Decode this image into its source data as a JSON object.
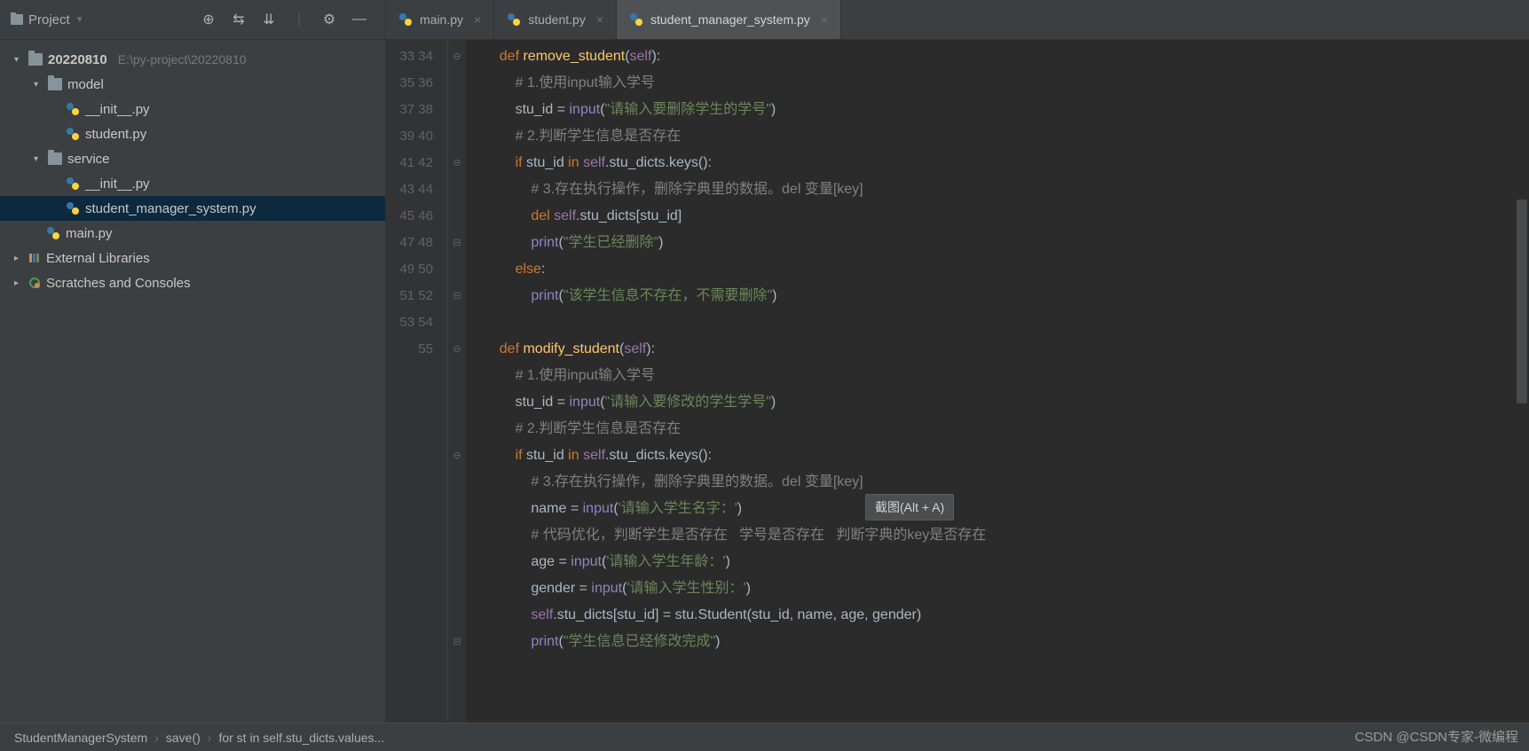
{
  "toolbar": {
    "project_label": "Project"
  },
  "tabs": [
    {
      "label": "main.py",
      "active": false
    },
    {
      "label": "student.py",
      "active": false
    },
    {
      "label": "student_manager_system.py",
      "active": true
    }
  ],
  "tree": {
    "root": {
      "name": "20220810",
      "hint": "E:\\py-project\\20220810"
    },
    "model": {
      "name": "model"
    },
    "model_init": {
      "name": "__init__.py"
    },
    "model_student": {
      "name": "student.py"
    },
    "service": {
      "name": "service"
    },
    "service_init": {
      "name": "__init__.py"
    },
    "service_sms": {
      "name": "student_manager_system.py"
    },
    "main": {
      "name": "main.py"
    },
    "ext_lib": {
      "name": "External Libraries"
    },
    "scratch": {
      "name": "Scratches and Consoles"
    }
  },
  "gutter": {
    "start": 33,
    "end": 55
  },
  "code_lines": [
    {
      "n": 33,
      "tokens": [
        [
          "    ",
          ""
        ],
        [
          "def ",
          "k"
        ],
        [
          "remove_student",
          "fn"
        ],
        [
          "(",
          "op"
        ],
        [
          "self",
          "pr"
        ],
        [
          "):",
          "op"
        ]
      ]
    },
    {
      "n": 34,
      "tokens": [
        [
          "        ",
          ""
        ],
        [
          "# 1.使用input输入学号",
          "c"
        ]
      ]
    },
    {
      "n": 35,
      "tokens": [
        [
          "        ",
          ""
        ],
        [
          "stu_id = ",
          "i"
        ],
        [
          "input",
          "builtin"
        ],
        [
          "(",
          "op"
        ],
        [
          "\"请输入要删除学生的学号\"",
          "s"
        ],
        [
          ")",
          "op"
        ]
      ]
    },
    {
      "n": 36,
      "tokens": [
        [
          "        ",
          ""
        ],
        [
          "# 2.判断学生信息是否存在",
          "c"
        ]
      ]
    },
    {
      "n": 37,
      "tokens": [
        [
          "        ",
          ""
        ],
        [
          "if ",
          "k"
        ],
        [
          "stu_id ",
          "i"
        ],
        [
          "in ",
          "k"
        ],
        [
          "self",
          "pr"
        ],
        [
          ".stu_dicts.keys():",
          "i"
        ]
      ]
    },
    {
      "n": 38,
      "tokens": [
        [
          "            ",
          ""
        ],
        [
          "# 3.存在执行操作，删除字典里的数据。del 变量[key]",
          "c"
        ]
      ]
    },
    {
      "n": 39,
      "tokens": [
        [
          "            ",
          ""
        ],
        [
          "del ",
          "k"
        ],
        [
          "self",
          "pr"
        ],
        [
          ".stu_dicts[stu_id]",
          "i"
        ]
      ]
    },
    {
      "n": 40,
      "tokens": [
        [
          "            ",
          ""
        ],
        [
          "print",
          "builtin"
        ],
        [
          "(",
          "op"
        ],
        [
          "\"学生已经删除\"",
          "s"
        ],
        [
          ")",
          "op"
        ]
      ]
    },
    {
      "n": 41,
      "tokens": [
        [
          "        ",
          ""
        ],
        [
          "else",
          "k"
        ],
        [
          ":",
          "op"
        ]
      ]
    },
    {
      "n": 42,
      "tokens": [
        [
          "            ",
          ""
        ],
        [
          "print",
          "builtin"
        ],
        [
          "(",
          "op"
        ],
        [
          "\"该学生信息不存在，不需要删除\"",
          "s"
        ],
        [
          ")",
          "op"
        ]
      ]
    },
    {
      "n": 43,
      "tokens": [
        [
          "",
          ""
        ]
      ]
    },
    {
      "n": 44,
      "tokens": [
        [
          "    ",
          ""
        ],
        [
          "def ",
          "k"
        ],
        [
          "modify_student",
          "fn"
        ],
        [
          "(",
          "op"
        ],
        [
          "self",
          "pr"
        ],
        [
          "):",
          "op"
        ]
      ]
    },
    {
      "n": 45,
      "tokens": [
        [
          "        ",
          ""
        ],
        [
          "# 1.使用input输入学号",
          "c"
        ]
      ]
    },
    {
      "n": 46,
      "tokens": [
        [
          "        ",
          ""
        ],
        [
          "stu_id = ",
          "i"
        ],
        [
          "input",
          "builtin"
        ],
        [
          "(",
          "op"
        ],
        [
          "\"请输入要修改的学生学号\"",
          "s"
        ],
        [
          ")",
          "op"
        ]
      ]
    },
    {
      "n": 47,
      "tokens": [
        [
          "        ",
          ""
        ],
        [
          "# 2.判断学生信息是否存在",
          "c"
        ]
      ]
    },
    {
      "n": 48,
      "tokens": [
        [
          "        ",
          ""
        ],
        [
          "if ",
          "k"
        ],
        [
          "stu_id ",
          "i"
        ],
        [
          "in ",
          "k"
        ],
        [
          "self",
          "pr"
        ],
        [
          ".stu_dicts.keys():",
          "i"
        ]
      ]
    },
    {
      "n": 49,
      "tokens": [
        [
          "            ",
          ""
        ],
        [
          "# 3.存在执行操作，删除字典里的数据。del 变量[key]",
          "c"
        ]
      ]
    },
    {
      "n": 50,
      "tokens": [
        [
          "            ",
          ""
        ],
        [
          "name = ",
          "i"
        ],
        [
          "input",
          "builtin"
        ],
        [
          "(",
          "op"
        ],
        [
          "'请输入学生名字：'",
          "s"
        ],
        [
          ")",
          "op"
        ]
      ]
    },
    {
      "n": 51,
      "tokens": [
        [
          "            ",
          ""
        ],
        [
          "# 代码优化，判断学生是否存在   学号是否存在   判断字典的key是否存在",
          "c"
        ]
      ]
    },
    {
      "n": 52,
      "tokens": [
        [
          "            ",
          ""
        ],
        [
          "age = ",
          "i"
        ],
        [
          "input",
          "builtin"
        ],
        [
          "(",
          "op"
        ],
        [
          "'请输入学生年龄：'",
          "s"
        ],
        [
          ")",
          "op"
        ]
      ]
    },
    {
      "n": 53,
      "tokens": [
        [
          "            ",
          ""
        ],
        [
          "gender = ",
          "i"
        ],
        [
          "input",
          "builtin"
        ],
        [
          "(",
          "op"
        ],
        [
          "'请输入学生性别：'",
          "s"
        ],
        [
          ")",
          "op"
        ]
      ]
    },
    {
      "n": 54,
      "tokens": [
        [
          "            ",
          ""
        ],
        [
          "self",
          "pr"
        ],
        [
          ".stu_dicts[stu_id] = stu.Student(stu_id, name, age, gender)",
          "i"
        ]
      ]
    },
    {
      "n": 55,
      "tokens": [
        [
          "            ",
          ""
        ],
        [
          "print",
          "builtin"
        ],
        [
          "(",
          "op"
        ],
        [
          "\"学生信息已经修改完成\"",
          "s"
        ],
        [
          ")",
          "op"
        ]
      ]
    }
  ],
  "fold_marks": {
    "33": "⊖",
    "34": "",
    "35": "",
    "36": "",
    "37": "⊖",
    "38": "",
    "39": "",
    "40": "⊟",
    "41": "",
    "42": "⊟",
    "43": "",
    "44": "⊖",
    "45": "",
    "46": "",
    "47": "",
    "48": "⊖",
    "49": "",
    "50": "",
    "51": "",
    "52": "",
    "53": "",
    "54": "",
    "55": "⊟"
  },
  "tooltip": {
    "text": "截图(Alt + A)"
  },
  "breadcrumb": {
    "class": "StudentManagerSystem",
    "method": "save()",
    "stmt": "for st in self.stu_dicts.values..."
  },
  "watermark": "CSDN @CSDN专家-微编程"
}
